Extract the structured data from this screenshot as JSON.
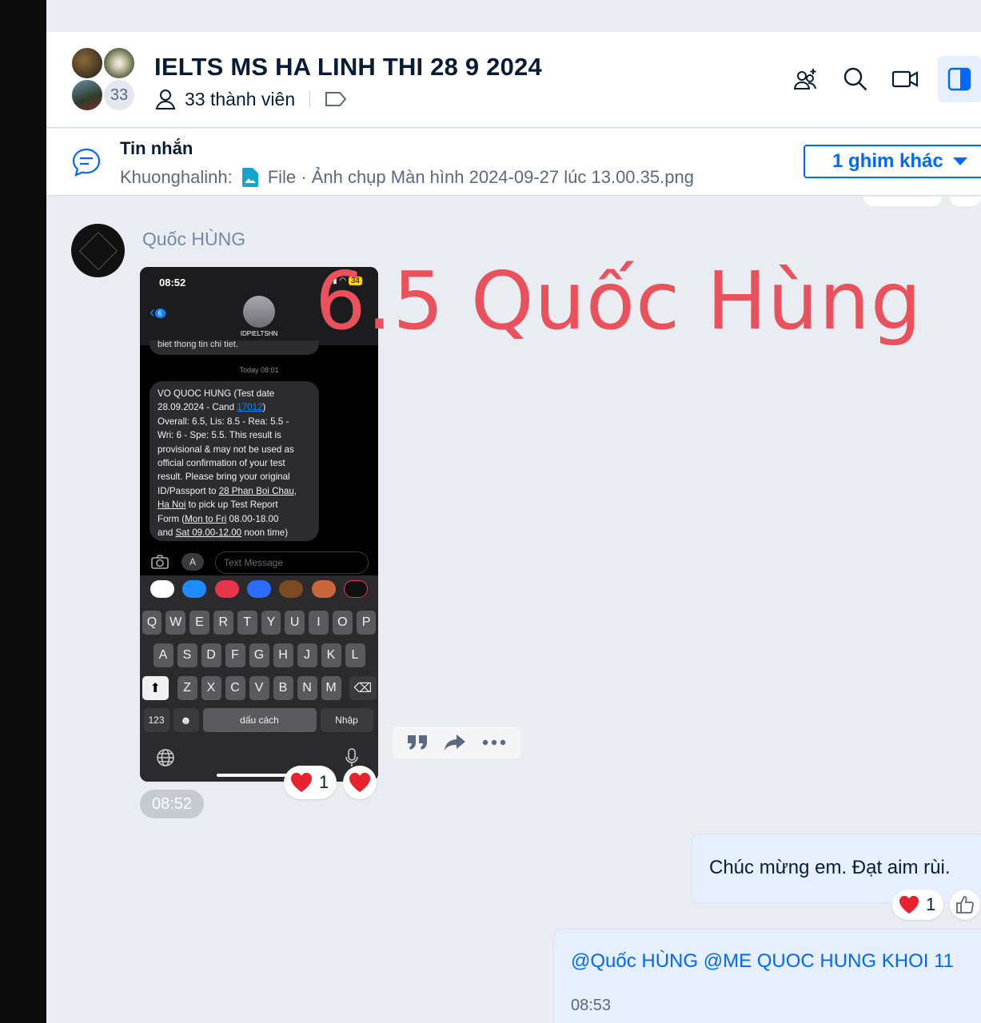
{
  "header": {
    "title": "IELTS MS HA LINH THI 28 9 2024",
    "member_count_badge": "33",
    "members_label": "33 thành viên"
  },
  "pinned": {
    "title": "Tin nhắn",
    "sender": "Khuonghalinh:",
    "file_label": "File · Ảnh chụp Màn hình 2024-09-27 lúc 13.00.35.png",
    "more_button": "1 ghim khác"
  },
  "incoming_message": {
    "sender_name": "Quốc HÙNG",
    "overlay_text": "6.5 Quốc Hùng",
    "time": "08:52",
    "reaction_count": "1",
    "phone": {
      "time": "08:52",
      "battery": "34",
      "back_badge": "6",
      "contact_name": "IDPIELTSHN",
      "prev_fragment": "biet thong tin chi tiet.",
      "today_label": "Today 08:01",
      "sms_lines": {
        "l1": "VO QUOC HUNG (Test date",
        "l2a": "28.09.2024 - Cand ",
        "l2b": "17012",
        "l2c": ")",
        "l3": "Overall: 6.5, Lis: 8.5 - Rea: 5.5 -",
        "l4": "Wri: 6 - Spe: 5.5. This result is",
        "l5": "provisional & may not be used as",
        "l6": "official confirmation of your test",
        "l7": "result. Please bring your original",
        "l8a": "ID/Passport to ",
        "l8b": "28 Phan Boi Chau,",
        "l9a": "Ha Noi",
        "l9b": " to pick up Test Report",
        "l10a": "Form (",
        "l10b": "Mon to Fri",
        "l10c": " 08.00-18.00",
        "l11a": "and ",
        "l11b": "Sat 09.00-12.00",
        "l11c": " noon time)"
      },
      "text_field_placeholder": "Text Message",
      "keyboard": {
        "row1": [
          "Q",
          "W",
          "E",
          "R",
          "T",
          "Y",
          "U",
          "I",
          "O",
          "P"
        ],
        "row2": [
          "A",
          "S",
          "D",
          "F",
          "G",
          "H",
          "J",
          "K",
          "L"
        ],
        "row3": [
          "Z",
          "X",
          "C",
          "V",
          "B",
          "N",
          "M"
        ],
        "numbers_key": "123",
        "space_key": "dấu cách",
        "return_key": "Nhập"
      }
    }
  },
  "outgoing_messages": [
    {
      "text": "Chúc mừng em. Đạt aim rùi.",
      "reaction_count": "1"
    },
    {
      "text": "@Quốc HÙNG @ME QUOC HUNG KHOI 11",
      "time": "08:53"
    }
  ],
  "colors": {
    "accent": "#0068ff",
    "overlay": "#e9525c",
    "heart": "#e8232f",
    "outgoing_bg": "#e5efff"
  },
  "icons": [
    "add-member-icon",
    "search-icon",
    "video-call-icon",
    "sidebar-toggle-icon",
    "message-icon",
    "tag-icon",
    "user-icon",
    "quote-icon",
    "forward-icon",
    "more-icon",
    "heart-icon",
    "like-icon"
  ]
}
